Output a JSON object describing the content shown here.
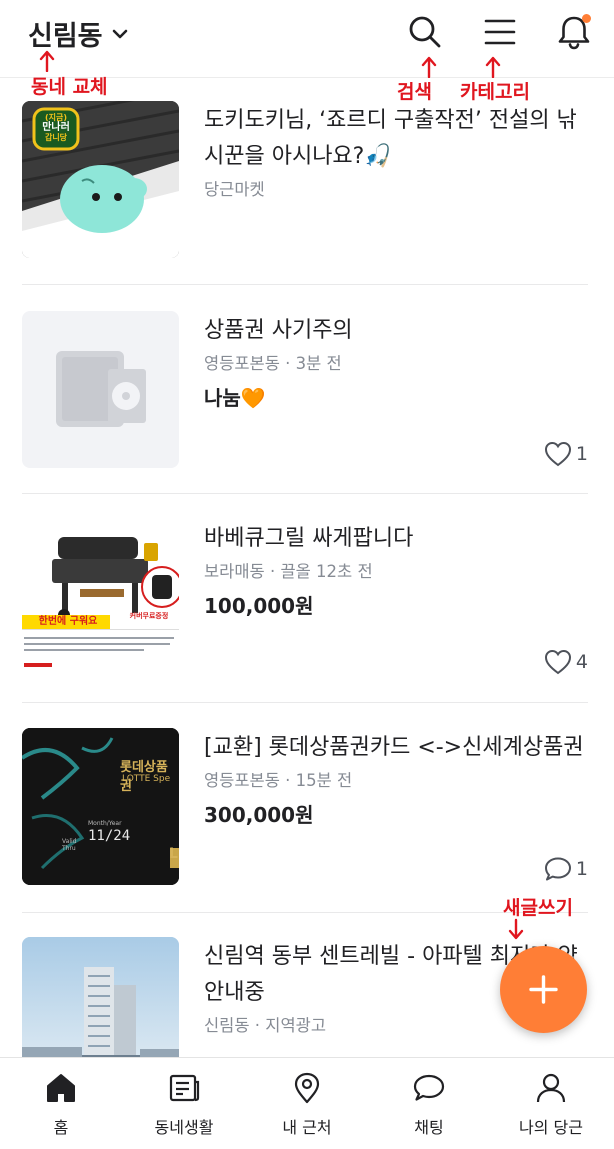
{
  "header": {
    "location": "신림동",
    "icons": [
      "chevron-down-icon",
      "search-icon",
      "menu-icon",
      "bell-icon"
    ],
    "has_notification_dot": true
  },
  "annotations": {
    "change_neighborhood": "동네 교체",
    "search": "검색",
    "category": "카테고리",
    "new_post": "새글쓰기"
  },
  "feed": [
    {
      "title": "도키도키님, ‘죠르디 구출작전’ 전설의 낚시꾼을 아시나요?🎣",
      "meta": "당근마켓",
      "price": "",
      "count": "",
      "counter_icon": "",
      "thumb_text": [
        "(지금)",
        "만나러",
        "갑니당"
      ]
    },
    {
      "title": "상품권 사기주의",
      "meta": "영등포본동 · 3분 전",
      "price": "나눔🧡",
      "count": "1",
      "counter_icon": "heart-icon"
    },
    {
      "title": "바베큐그릴 싸게팝니다",
      "meta": "보라매동 · 끌올 12초 전",
      "price": "100,000원",
      "count": "4",
      "counter_icon": "heart-icon",
      "thumb_text": [
        "한번에 구워요",
        "커버무료증정"
      ]
    },
    {
      "title": "[교환] 롯데상품권카드 <->신세계상품권",
      "meta": "영등포본동 · 15분 전",
      "price": "300,000원",
      "count": "1",
      "counter_icon": "chat-icon",
      "thumb_text": [
        "롯데상품권",
        "LOTTE Spe",
        "Month/Year",
        "Valid Thru",
        "11/24",
        "L"
      ]
    },
    {
      "title": "신림역 동부 센트레빌 - 아파텔 최저가 약안내중",
      "meta": "신림동 · 지역광고",
      "price": "",
      "count": "",
      "counter_icon": ""
    }
  ],
  "fab": {
    "icon": "plus-icon"
  },
  "nav": [
    {
      "label": "홈",
      "icon": "home-icon"
    },
    {
      "label": "동네생활",
      "icon": "community-icon"
    },
    {
      "label": "내 근처",
      "icon": "location-pin-icon"
    },
    {
      "label": "채팅",
      "icon": "chat-icon"
    },
    {
      "label": "나의 당근",
      "icon": "user-icon"
    }
  ],
  "colors": {
    "accent": "#ff7e36",
    "annotation": "#e0161f",
    "meta_text": "#868b94",
    "divider": "#e9e9ea"
  }
}
